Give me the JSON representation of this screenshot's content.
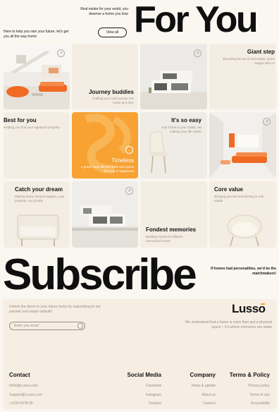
{
  "hero": {
    "tagline": "Real estate for your world, you deserve a home you love",
    "title": "For You",
    "subtitle": "Here to help you own your future, let's get you all the way home",
    "view_all": "View all"
  },
  "tiles": {
    "journey": {
      "title": "Journey buddies",
      "desc": "Crafting your real journey one home at a time"
    },
    "giant": {
      "title": "Giant step",
      "desc": "Elevating the art of real estate, home begins with us"
    },
    "best": {
      "title": "Best for you",
      "desc": "Helping you find your signature property"
    },
    "timeless": {
      "title": "Timeless",
      "desc": "A great home lifts the spirit and opens the soul to happiness"
    },
    "easy": {
      "title": "It's so easy",
      "desc": "Your home is your castle, we making your life easier"
    },
    "dream": {
      "title": "Catch your dream",
      "desc": "Making home dreams happen, your property, our priority"
    },
    "fondest": {
      "title": "Fondest memories",
      "desc": "Building homes for lifetime memories forever"
    },
    "core": {
      "title": "Core value",
      "desc": "Bringing you the best feeling in real estate"
    }
  },
  "subscribe": {
    "title": "Subscribe",
    "tagline": "If homes had personalities, we'd be the matchmakers!",
    "intro": "Unlock the doors to your future home by subscribing to our premier real estate website!",
    "email_placeholder": "Enter you email",
    "logo": "Lusso",
    "footer_tag": "We understand that a home is more than just a physical space – it's where memories are made"
  },
  "footer": {
    "contact": {
      "title": "Contact",
      "items": [
        "Hello@Lusso.com",
        "Support@Lusso.com",
        "+1234 5678 90"
      ]
    },
    "social": {
      "title": "Social Media",
      "items": [
        "Facebook",
        "Instagram",
        "Youtube"
      ]
    },
    "company": {
      "title": "Company",
      "items": [
        "News & update",
        "About us",
        "Careers"
      ]
    },
    "terms": {
      "title": "Terms & Policy",
      "items": [
        "Privacy policy",
        "Terms of use",
        "Accessibility"
      ]
    }
  },
  "colors": {
    "accent": "#f7a233",
    "background": "#faf6f0",
    "footer_bg": "#f6eee3",
    "text": "#141414",
    "muted": "#9a8f84"
  },
  "icons": [
    "arrow-up-right-icon",
    "arrow-right-icon"
  ]
}
